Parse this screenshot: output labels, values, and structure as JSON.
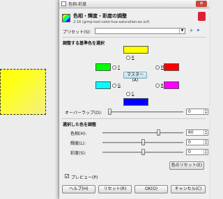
{
  "window": {
    "title": "色相-彩度"
  },
  "header": {
    "title": "色相・輝度・彩度の調整",
    "subtitle": "2-16 (gimp-tool-color-hue-saturation-ex.xcf)"
  },
  "presets": {
    "label": "プリセット(S):",
    "value": ""
  },
  "primary": {
    "section_label": "調整する基準色を選択",
    "radios": {
      "r": "R",
      "y": "Y",
      "g": "G",
      "c": "C",
      "b": "B",
      "m": "M"
    },
    "master_label": "マスター(A)",
    "colors": {
      "red": "#ff0000",
      "yellow": "#ffff00",
      "green": "#00ff00",
      "cyan": "#00ffff",
      "blue": "#0000ff",
      "magenta": "#ff00ff"
    }
  },
  "overlap": {
    "label": "オーバーラップ(O):",
    "value": "0"
  },
  "adjust": {
    "section_label": "選択した色を調整",
    "hue": {
      "label": "色相(H):",
      "value": "60",
      "fraction": 0.667
    },
    "lightness": {
      "label": "輝度(L):",
      "value": "0",
      "fraction": 0.5
    },
    "saturation": {
      "label": "彩度(S):",
      "value": "0",
      "fraction": 0.5
    },
    "reset_color_label": "色のリセット(E)"
  },
  "preview": {
    "label": "プレビュー(P)",
    "checked": true
  },
  "buttons": {
    "help": "ヘルプ(H)",
    "reset": "リセット(R)",
    "ok": "OK(O)",
    "cancel": "キャンセル(C)"
  }
}
